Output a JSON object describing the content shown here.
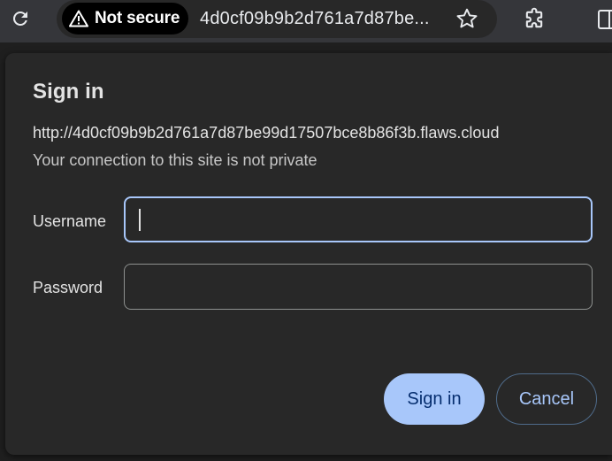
{
  "toolbar": {
    "reload_icon": "reload-icon",
    "security_chip": {
      "icon": "warning-triangle-icon",
      "label": "Not secure"
    },
    "url_display": "4d0cf09b9b2d761a7d87be...",
    "star_icon": "bookmark-star-icon",
    "extensions_icon": "extensions-puzzle-icon",
    "side_panel_icon": "side-panel-icon"
  },
  "dialog": {
    "title": "Sign in",
    "origin": "http://4d0cf09b9b2d761a7d87be99d17507bce8b86f3b.flaws.cloud",
    "warning": "Your connection to this site is not private",
    "username_label": "Username",
    "username_value": "",
    "password_label": "Password",
    "password_value": "",
    "signin_label": "Sign in",
    "cancel_label": "Cancel"
  },
  "colors": {
    "toolbar_bg": "#35363a",
    "dialog_bg": "#282828",
    "accent": "#a8c7fa",
    "accent_text": "#062e6f"
  }
}
